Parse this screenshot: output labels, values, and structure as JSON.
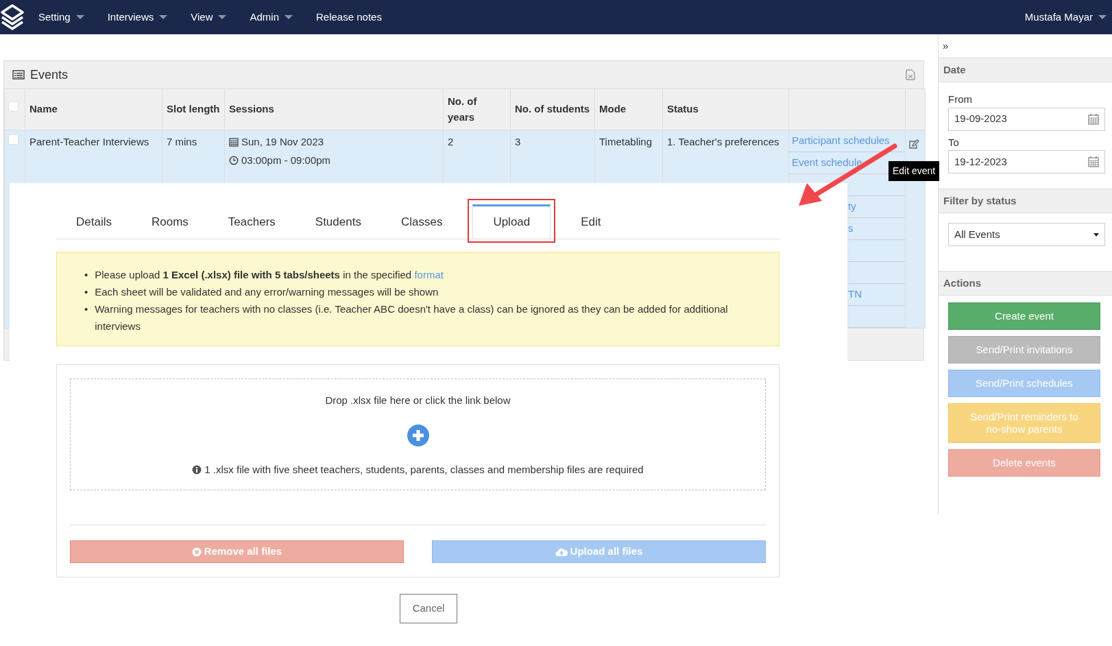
{
  "navbar": {
    "menus": [
      {
        "label": "Setting",
        "dropdown": true
      },
      {
        "label": "Interviews",
        "dropdown": true
      },
      {
        "label": "View",
        "dropdown": true
      },
      {
        "label": "Admin",
        "dropdown": true
      },
      {
        "label": "Release notes",
        "dropdown": false
      }
    ],
    "user": {
      "label": "Mustafa Mayar",
      "dropdown": true
    }
  },
  "events_panel": {
    "title": "Events",
    "table": {
      "columns": [
        "Name",
        "Slot length",
        "Sessions",
        "No. of years",
        "No. of students",
        "Mode",
        "Status"
      ],
      "header_checked": false,
      "rows": [
        {
          "checked": false,
          "name": "Parent-Teacher Interviews",
          "slot_length": "7 mins",
          "session_date": "Sun, 19 Nov 2023",
          "session_time": "03:00pm - 09:00pm",
          "years": "2",
          "students": "3",
          "mode": "Timetabling",
          "status": "1. Teacher's preferences",
          "links": [
            {
              "text": "Participant schedules",
              "covered": false
            },
            {
              "text": "Event schedule",
              "covered": false
            },
            {
              "kind": "blank"
            },
            {
              "text": "ty",
              "covered": true
            },
            {
              "text": "s",
              "covered": true
            },
            {
              "kind": "blank"
            },
            {
              "kind": "blank"
            },
            {
              "text": "TN",
              "covered": true
            },
            {
              "kind": "blank"
            }
          ],
          "tooltip": "Edit event"
        }
      ]
    }
  },
  "upload_panel": {
    "tabs": [
      {
        "label": "Details",
        "selected": false,
        "highlighted": false
      },
      {
        "label": "Rooms",
        "selected": false,
        "highlighted": false
      },
      {
        "label": "Teachers",
        "selected": false,
        "highlighted": false
      },
      {
        "label": "Students",
        "selected": false,
        "highlighted": false
      },
      {
        "label": "Classes",
        "selected": false,
        "highlighted": false
      },
      {
        "label": "Upload",
        "selected": true,
        "highlighted": true
      },
      {
        "label": "Edit",
        "selected": false,
        "highlighted": false
      }
    ],
    "instructions": [
      {
        "marker": "•",
        "text": "Please upload **1 Excel (.xlsx) file with 5 tabs/sheets** in the specified",
        "link": "format"
      },
      {
        "marker": "•",
        "text": "Each sheet will be validated and any error/warning messages will be shown"
      },
      {
        "marker": "•",
        "text": "Warning messages for teachers with no classes (i.e. Teacher ABC doesn't have a class) can be ignored as they can be added for additional interviews"
      }
    ],
    "dropzone": {
      "prompt": "Drop .xlsx file here or click the link below",
      "note": "1 .xlsx file with five sheet teachers, students, parents, classes and membership files are required"
    },
    "buttons": [
      {
        "label": "Remove all files",
        "kind": "remove"
      },
      {
        "label": "Upload all files",
        "kind": "upload"
      }
    ],
    "cancel": "Cancel"
  },
  "sidebar": {
    "collapse": "»",
    "date": {
      "title": "Date",
      "from_label": "From",
      "from_value": "19-09-2023",
      "to_label": "To",
      "to_value": "19-12-2023"
    },
    "filter": {
      "title": "Filter by status",
      "value": "All Events"
    },
    "actions": {
      "title": "Actions",
      "buttons": [
        {
          "label": "Create event",
          "kind": "success"
        },
        {
          "label": "Send/Print invitations",
          "kind": "secondary"
        },
        {
          "label": "Send/Print schedules",
          "kind": "info"
        },
        {
          "label": "Send/Print reminders to no-show parents",
          "kind": "warning"
        },
        {
          "label": "Delete events",
          "kind": "danger"
        }
      ]
    }
  }
}
